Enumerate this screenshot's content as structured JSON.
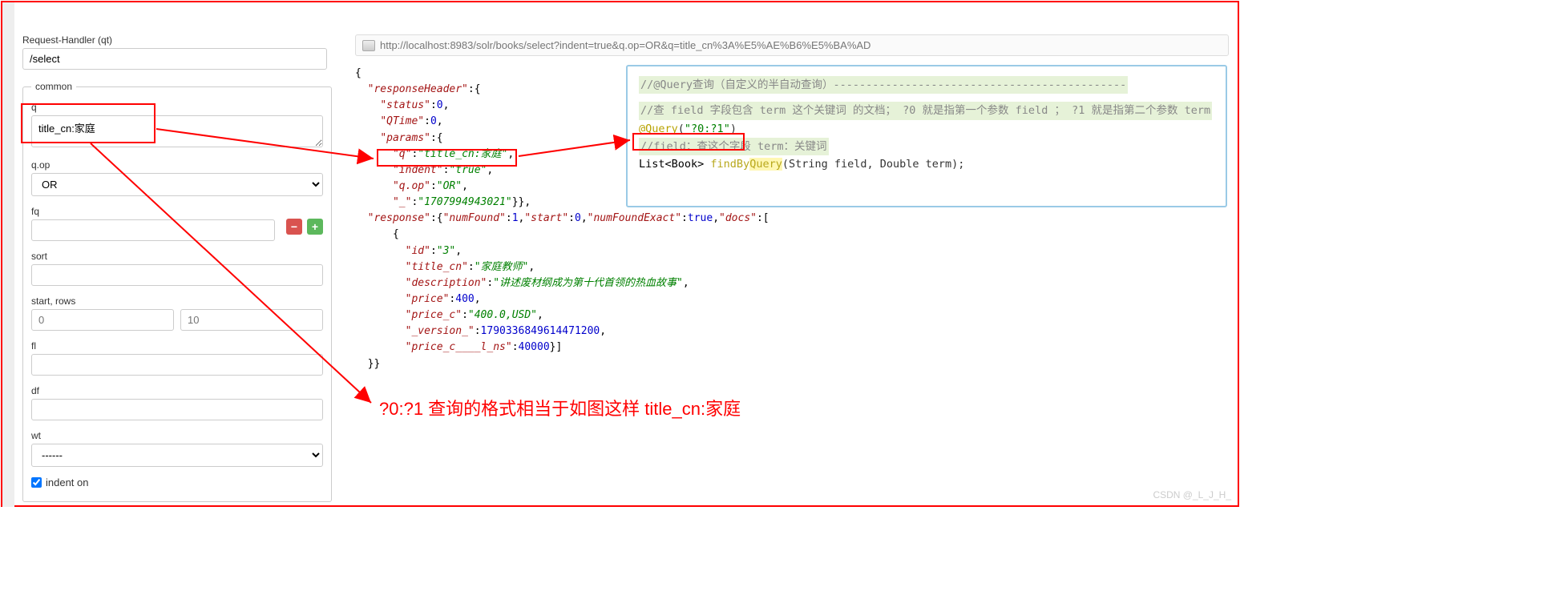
{
  "handler": {
    "label": "Request-Handler (qt)",
    "value": "/select"
  },
  "common_legend": "common",
  "fields": {
    "q": {
      "label": "q",
      "value": "title_cn:家庭"
    },
    "qop": {
      "label": "q.op",
      "value": "OR"
    },
    "fq": {
      "label": "fq",
      "value": ""
    },
    "sort": {
      "label": "sort",
      "value": ""
    },
    "startrows": {
      "label": "start, rows",
      "start": "0",
      "rows": "10"
    },
    "fl": {
      "label": "fl",
      "value": ""
    },
    "df": {
      "label": "df",
      "value": ""
    },
    "wt": {
      "label": "wt",
      "value": "------"
    },
    "indent": {
      "label": "indent on",
      "checked": true
    }
  },
  "url": "http://localhost:8983/solr/books/select?indent=true&q.op=OR&q=title_cn%3A%E5%AE%B6%E5%BA%AD",
  "response": {
    "responseHeader": {
      "status": 0,
      "QTime": 0,
      "params": {
        "q": "title_cn:家庭",
        "indent": "true",
        "q.op": "OR",
        "_": "1707994943021"
      }
    },
    "response": {
      "numFound": 1,
      "start": 0,
      "numFoundExact": true,
      "docs": [
        {
          "id": "3",
          "title_cn": "家庭教师",
          "description": "讲述废材纲成为第十代首领的热血故事",
          "price": 400.0,
          "price_c": "400.0,USD",
          "_version_": 1790336849614471168,
          "price_c____l_ns": 40000
        }
      ]
    }
  },
  "code": {
    "c1": "//@Query查询（自定义的半自动查询）---------------------------------------------",
    "c2": "//查 field 字段包含 term 这个关键词 的文档；   ?0 就是指第一个参数 field  ； ?1 就是指第二个参数 term",
    "anno": "@Query",
    "annoArg": "\"?0:?1\"",
    "c3": "//field：查这个字段      term：关键词",
    "ret": "List<Book> ",
    "fn": "findByQuery",
    "sig": "(String field, Double term);"
  },
  "annotation": "?0:?1    查询的格式相当于如图这样    title_cn:家庭",
  "watermark": "CSDN @_L_J_H_"
}
